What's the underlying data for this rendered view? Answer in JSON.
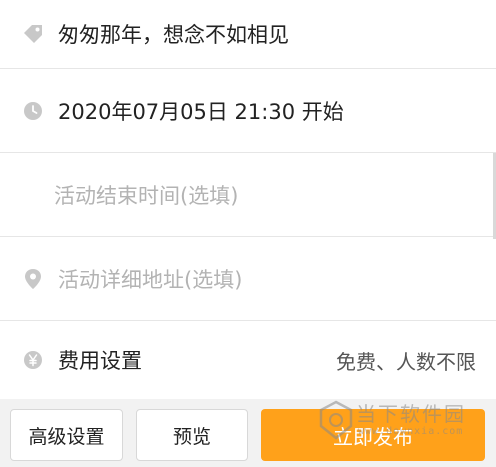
{
  "form": {
    "title": {
      "icon": "tag-icon",
      "value": "匆匆那年，想念不如相见"
    },
    "start_time": {
      "icon": "clock-icon",
      "value": "2020年07月05日 21:30 开始"
    },
    "end_time": {
      "placeholder": "活动结束时间(选填)"
    },
    "address": {
      "icon": "location-pin-icon",
      "placeholder": "活动详细地址(选填)"
    },
    "fee": {
      "icon": "yen-icon",
      "label": "费用设置",
      "value": "免费、人数不限"
    }
  },
  "bottom_bar": {
    "advanced_label": "高级设置",
    "preview_label": "预览",
    "publish_label": "立即发布"
  },
  "watermark": {
    "text": "当下软件园",
    "sub": "www.downxia.com"
  },
  "colors": {
    "accent": "#ffa11a",
    "icon_gray": "#c8c8c8",
    "placeholder": "#b3b3b3",
    "divider": "#e6e6e6",
    "bar_bg": "#f2f2f2"
  }
}
